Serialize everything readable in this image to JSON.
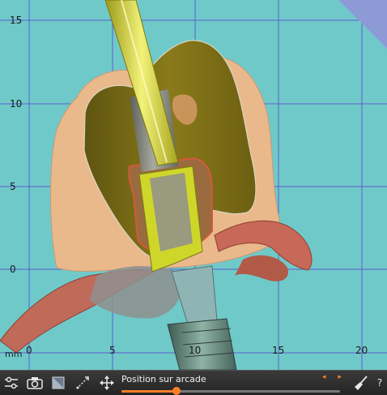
{
  "viewport": {
    "y_axis_labels": [
      "15",
      "10",
      "5",
      "0"
    ],
    "y_unit": "mm",
    "x_axis_labels": [
      "0",
      "5",
      "10",
      "15",
      "20"
    ]
  },
  "toolbar": {
    "slider_label": "Position sur arcade",
    "slider_value_fraction": 0.25,
    "help_label": "?"
  },
  "colors": {
    "background": "#70c9c9",
    "grid": "#5a5fd0",
    "slider_accent": "#ff7f27",
    "crown": "#8a7a1a",
    "implant": "#d8e030"
  }
}
